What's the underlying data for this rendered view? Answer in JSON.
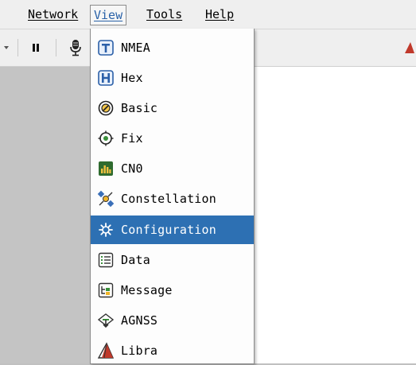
{
  "menubar": {
    "items": [
      {
        "label": "Network"
      },
      {
        "label": "View"
      },
      {
        "label": "Tools"
      },
      {
        "label": "Help"
      }
    ]
  },
  "toolbar": {
    "items": [
      {
        "icon": "dropdown-arrow-icon"
      },
      {
        "icon": "pause-icon"
      },
      {
        "icon": "microphone-icon"
      }
    ]
  },
  "view_menu": {
    "items": [
      {
        "label": "NMEA",
        "icon": "text-t-icon"
      },
      {
        "label": "Hex",
        "icon": "hex-h-icon"
      },
      {
        "label": "Basic",
        "icon": "basic-compass-icon"
      },
      {
        "label": "Fix",
        "icon": "fix-target-icon"
      },
      {
        "label": "CN0",
        "icon": "cn0-bar-chart-icon"
      },
      {
        "label": "Constellation",
        "icon": "satellite-icon"
      },
      {
        "label": "Configuration",
        "icon": "gear-icon",
        "selected": true
      },
      {
        "label": "Data",
        "icon": "data-list-icon"
      },
      {
        "label": "Message",
        "icon": "message-tree-icon"
      },
      {
        "label": "AGNSS",
        "icon": "agnss-icon"
      },
      {
        "label": "Libra",
        "icon": "libra-icon"
      }
    ]
  },
  "colors": {
    "selection": "#2d70b3",
    "menu_active_text": "#2a62a8",
    "workspace": "#c4c4c4"
  }
}
